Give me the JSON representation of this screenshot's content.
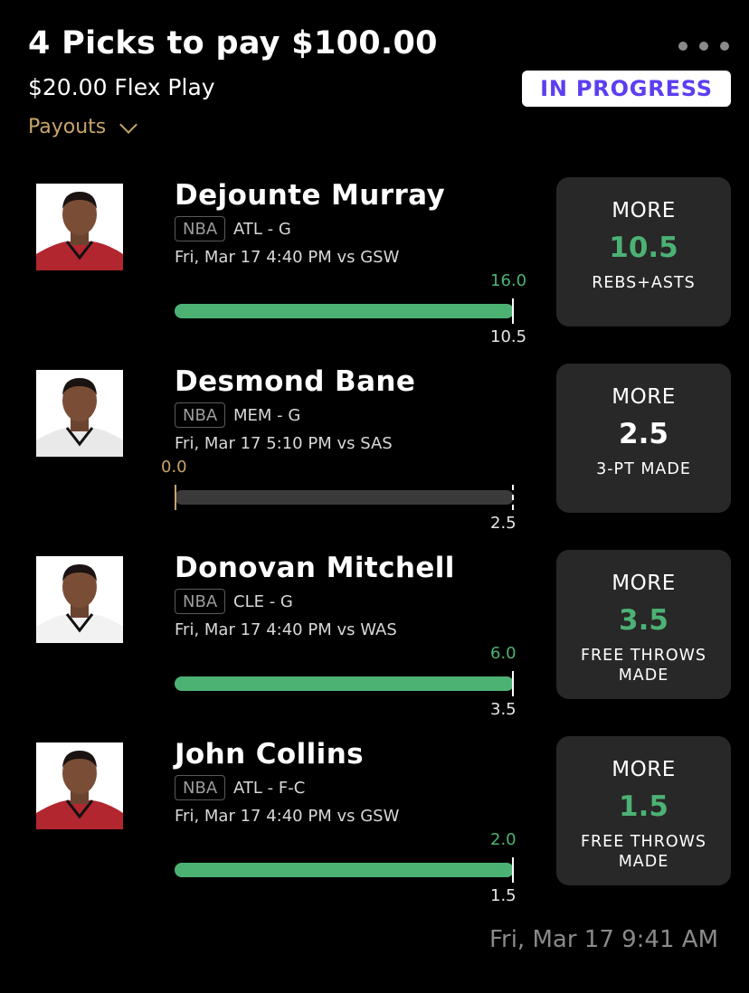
{
  "header": {
    "title": "4 Picks to pay $100.00",
    "subtitle": "$20.00 Flex Play",
    "payouts_label": "Payouts",
    "status_badge": "IN PROGRESS"
  },
  "picks": [
    {
      "player": "Dejounte Murray",
      "league": "NBA",
      "team": "ATL - G",
      "when": "Fri, Mar 17 4:40 PM  vs GSW",
      "actual": "16.0",
      "line": "10.5",
      "direction": "MORE",
      "line_value": "10.5",
      "stat": "REBS+ASTS",
      "progress": 1.0,
      "jersey_color": "#b2262f"
    },
    {
      "player": "Desmond Bane",
      "league": "NBA",
      "team": "MEM - G",
      "when": "Fri, Mar 17 5:10 PM  vs SAS",
      "actual": "0.0",
      "line": "2.5",
      "direction": "MORE",
      "line_value": "2.5",
      "stat": "3-PT MADE",
      "progress": 0.0,
      "jersey_color": "#e9e9e9"
    },
    {
      "player": "Donovan Mitchell",
      "league": "NBA",
      "team": "CLE - G",
      "when": "Fri, Mar 17 4:40 PM  vs WAS",
      "actual": "6.0",
      "line": "3.5",
      "direction": "MORE",
      "line_value": "3.5",
      "stat": "FREE THROWS MADE",
      "progress": 1.0,
      "jersey_color": "#f2f2f2"
    },
    {
      "player": "John Collins",
      "league": "NBA",
      "team": "ATL - F-C",
      "when": "Fri, Mar 17 4:40 PM  vs GSW",
      "actual": "2.0",
      "line": "1.5",
      "direction": "MORE",
      "line_value": "1.5",
      "stat": "FREE THROWS MADE",
      "progress": 1.0,
      "jersey_color": "#b2262f"
    }
  ],
  "footer": {
    "timestamp": "Fri, Mar 17 9:41 AM"
  },
  "colors": {
    "accent_green": "#4cb274",
    "accent_gold": "#c9a46a",
    "badge_purple": "#5b3ff0",
    "card_bg": "#282828"
  }
}
